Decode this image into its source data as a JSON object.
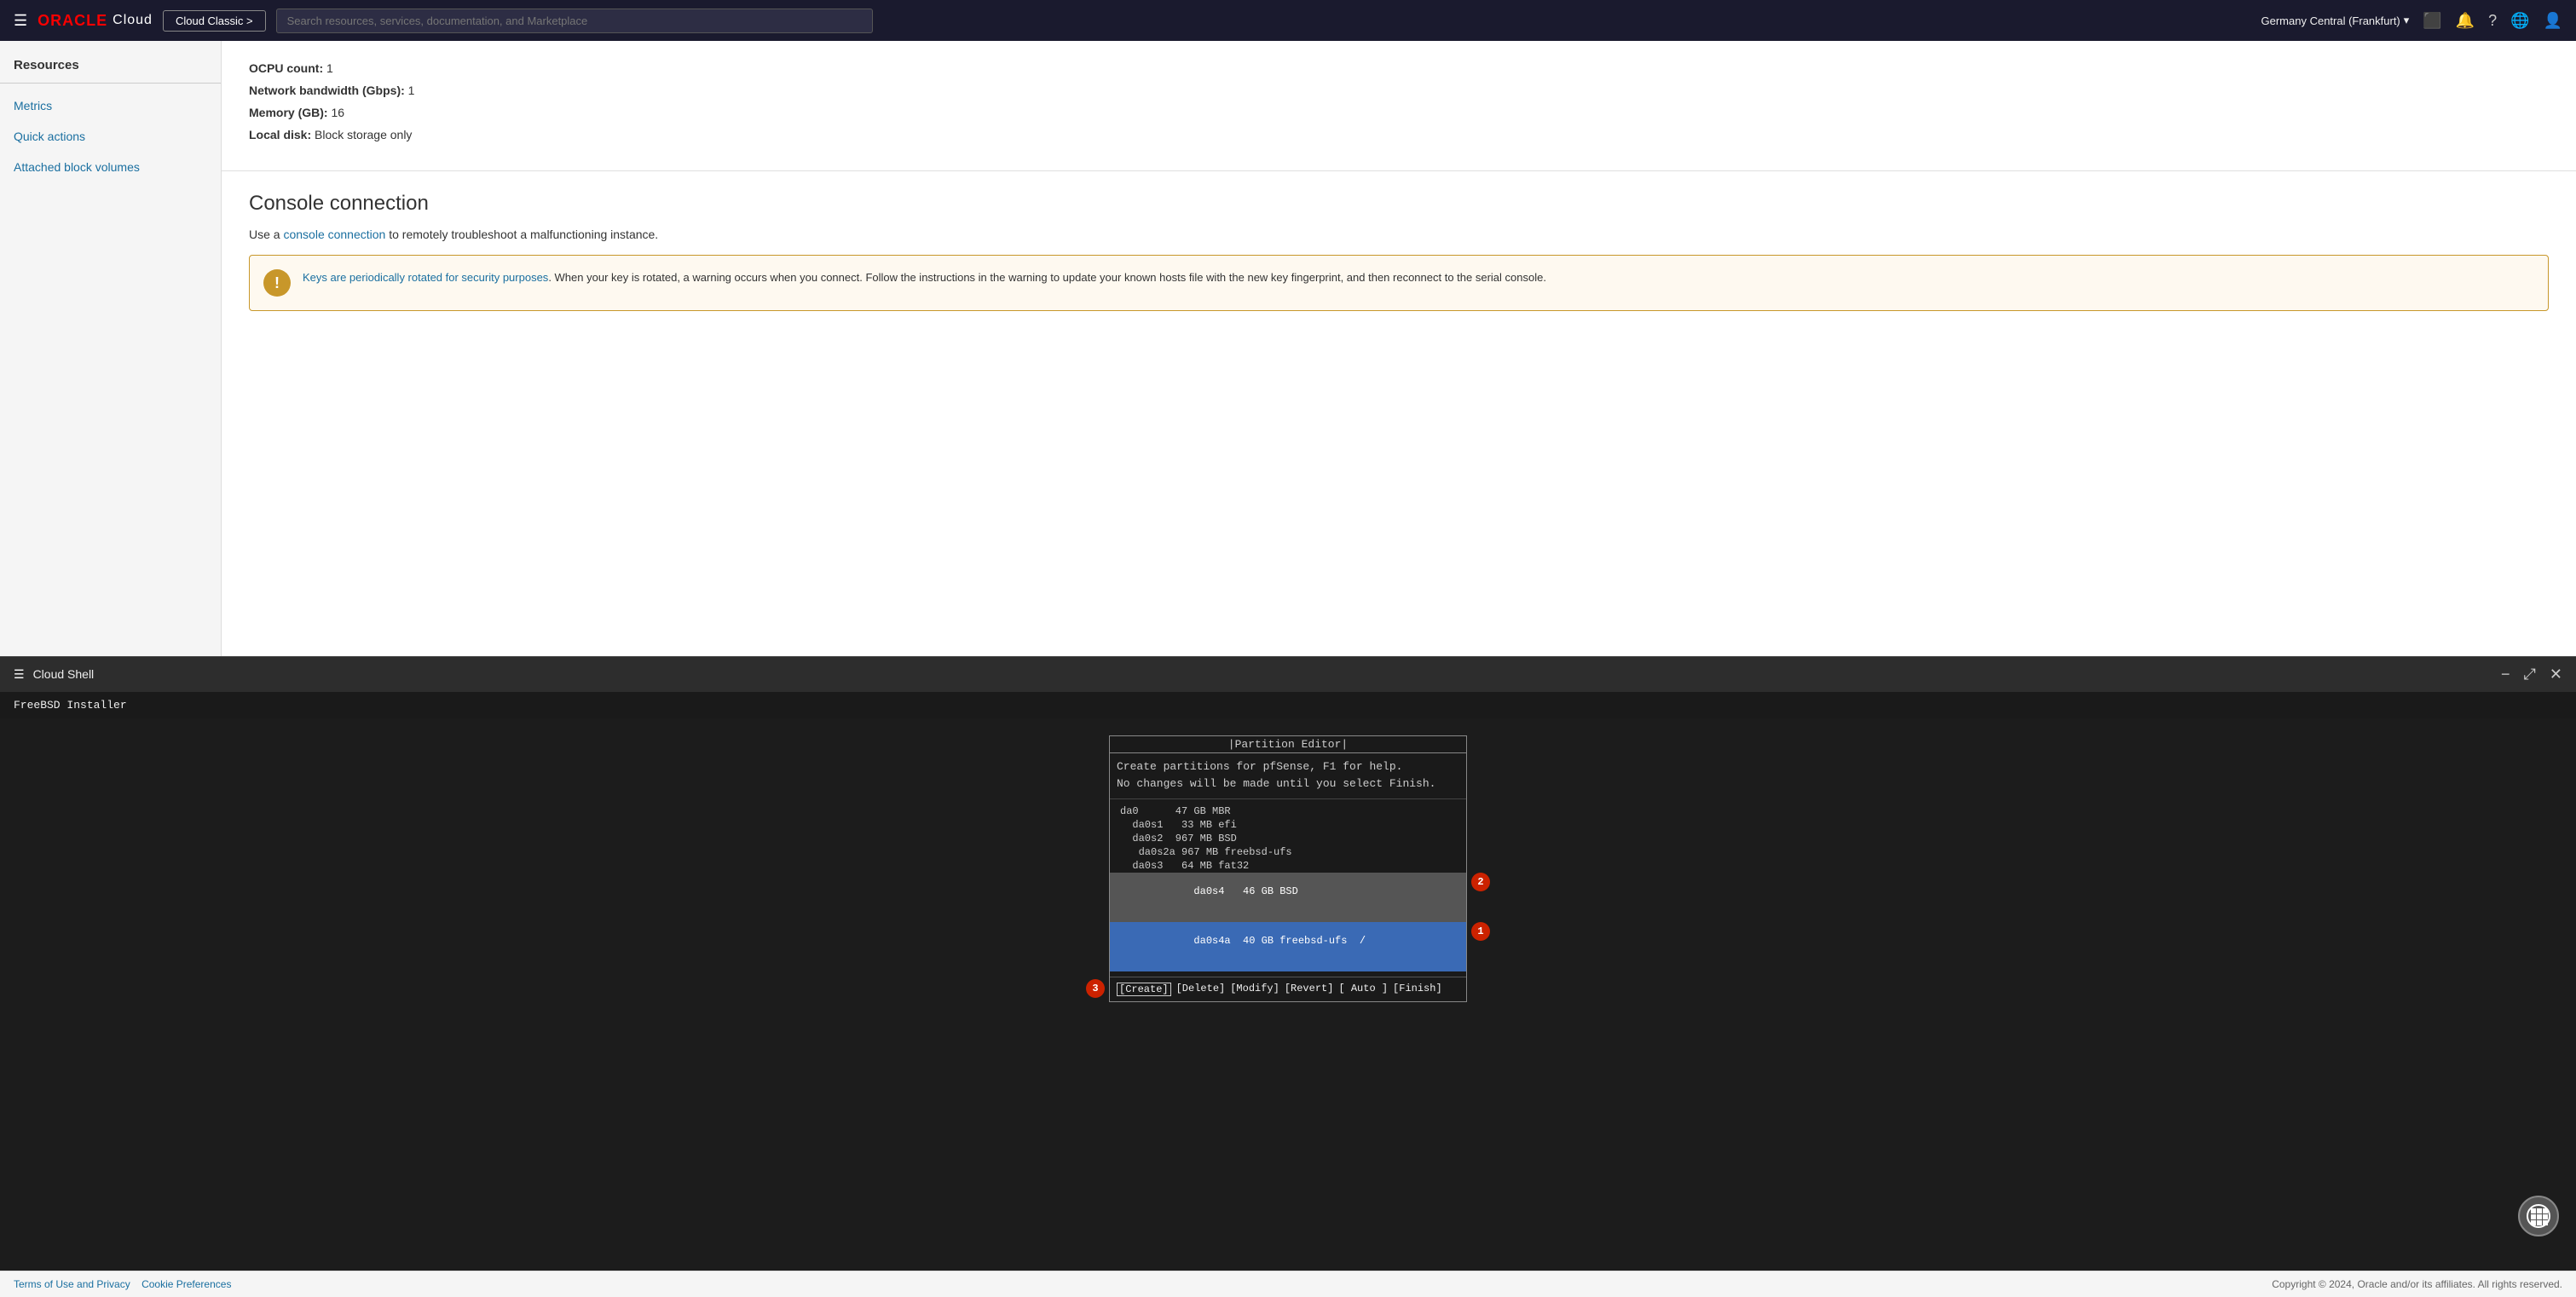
{
  "navbar": {
    "hamburger_label": "☰",
    "logo_oracle": "ORACLE",
    "logo_cloud": "Cloud",
    "cloud_btn": "Cloud Classic >",
    "search_placeholder": "Search resources, services, documentation, and Marketplace",
    "region": "Germany Central (Frankfurt)",
    "region_chevron": "▾",
    "icons": {
      "terminal": "⬛",
      "bell": "🔔",
      "help": "?",
      "globe": "🌐",
      "user": "👤"
    }
  },
  "sidebar": {
    "section_title": "Resources",
    "links": [
      {
        "id": "metrics",
        "label": "Metrics"
      },
      {
        "id": "quick-actions",
        "label": "Quick actions"
      },
      {
        "id": "attached-block-volumes",
        "label": "Attached block volumes"
      }
    ]
  },
  "info_box": {
    "rows": [
      {
        "label": "OCPU count:",
        "value": "1"
      },
      {
        "label": "Network bandwidth (Gbps):",
        "value": "1"
      },
      {
        "label": "Memory (GB):",
        "value": "16"
      },
      {
        "label": "Local disk:",
        "value": "Block storage only"
      }
    ]
  },
  "console_section": {
    "title": "Console connection",
    "description_prefix": "Use a",
    "link_text": "console connection",
    "description_suffix": "to remotely troubleshoot a malfunctioning instance.",
    "warning": {
      "icon": "!",
      "link_text": "Keys are periodically rotated for security purposes",
      "text": ". When your key is rotated, a warning occurs when you connect. Follow the instructions in the warning to update your known hosts file with the new key fingerprint, and then reconnect to the serial console."
    }
  },
  "cloud_shell": {
    "bar_icon": "☰",
    "title": "Cloud Shell",
    "minimize_icon": "−",
    "expand_icon": "⤢",
    "close_icon": "✕"
  },
  "terminal": {
    "installer_label": "FreeBSD Installer",
    "partition_editor": {
      "title": "Partition Editor",
      "line1": "Create partitions for pfSense, F1 for help.",
      "line2": "No changes will be made until you select Finish.",
      "partitions": [
        {
          "name": "da0",
          "size": "47 GB",
          "type": "MBR",
          "extra": ""
        },
        {
          "name": "da0s1",
          "size": "33 MB",
          "type": "efi",
          "extra": ""
        },
        {
          "name": "da0s2",
          "size": "967 MB",
          "type": "BSD",
          "extra": ""
        },
        {
          "name": "da0s2a",
          "size": "967 MB",
          "type": "freebsd-ufs",
          "extra": ""
        },
        {
          "name": "da0s3",
          "size": "64 MB",
          "type": "fat32",
          "extra": ""
        },
        {
          "name": "da0s4",
          "size": "46 GB",
          "type": "BSD",
          "extra": "",
          "selected": true
        },
        {
          "name": "da0s4a",
          "size": "40 GB",
          "type": "freebsd-ufs",
          "extra": "/",
          "highlighted": true
        }
      ],
      "actions": [
        "[Create]",
        "[Delete]",
        "[Modify]",
        "[Revert]",
        "[ Auto ]",
        "[Finish]"
      ],
      "active_action": "[Create]"
    },
    "badges": [
      {
        "number": "1",
        "label": "badge-1"
      },
      {
        "number": "2",
        "label": "badge-2"
      },
      {
        "number": "3",
        "label": "badge-3"
      }
    ]
  },
  "footer": {
    "left_links": [
      {
        "label": "Terms of Use and Privacy"
      },
      {
        "label": "Cookie Preferences"
      }
    ],
    "right_text": "Copyright © 2024, Oracle and/or its affiliates. All rights reserved."
  }
}
